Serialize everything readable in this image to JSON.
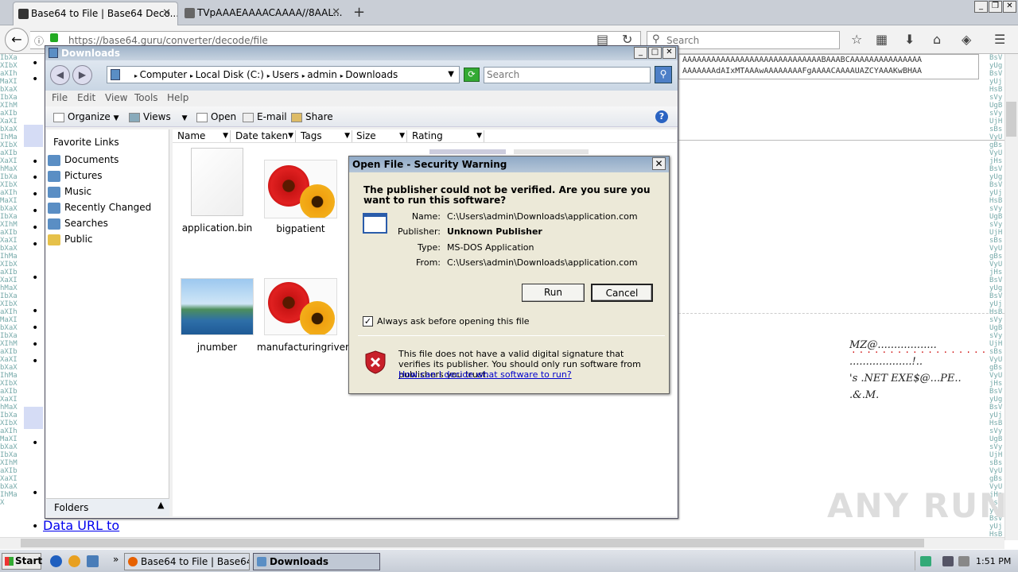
{
  "browser": {
    "tabs": [
      {
        "label": "Base64 to File | Base64 Deco...",
        "active": true
      },
      {
        "label": "TVpAAAEAAAACAAAA//8AAL...",
        "active": false
      }
    ],
    "url": "https://base64.guru/converter/decode/file",
    "search_placeholder": "Search"
  },
  "page": {
    "textarea_lines": [
      "AAAAAAAAAAAAAAAAAAAAAAAAAAAAABAAABCAAAAAAAAAAAAAAA",
      "AAAAAAAdAIxMTAAAwAAAAAAAAFgAAAACAAAAUAZCYAAAKwBHAA"
    ],
    "data_url_link": "Data URL to",
    "decoded_lines": [
      "MZ@..................",
      "...................!..",
      "'s .NET EXE$@...PE..",
      ".&.M."
    ],
    "left_strip": "IbXaXIbXaXIhMaXIbXaXIbXaXIhMaXIbXaXIbXaXIhMaXIbXaXIbXaXIhMaXIbXaXIbXaXIhMaXIbXaXIbXaXIhMaXIbXaXIbXaXIhMaXIbXaXIbXaXIhMaXIbXaXIbXaXIhMaXIbXaXIbXaXIhMaXIbXaXIbXaXIhMaXIbXaXIbXaXIhMaXIbXaXIbXaXIhMaXIbXaXIbXaXIhMaXIbXaXIbXaXIhMaX",
    "right_strip": "BsVyUgBsVyUjHsBsVyUgBsVyUjHsBsVyUgBsVyUjHsBsVyUgBsVyUjHsBsVyUgBsVyUjHsBsVyUgBsVyUjHsBsVyUgBsVyUjHsBsVyUgBsVyUjHsBsVyUgBsVyUjHsBsVyUgBsVyUjHsBsVyUgBsVyUjHsBsVyUgBsVyUjHsBsVyUgBsVyUjHsBsVyUgBsVyUjHs",
    "watermark": "ANY RUN"
  },
  "explorer": {
    "title": "Downloads",
    "breadcrumb": [
      "Computer",
      "Local Disk (C:)",
      "Users",
      "admin",
      "Downloads"
    ],
    "search_placeholder": "Search",
    "menu": [
      "File",
      "Edit",
      "View",
      "Tools",
      "Help"
    ],
    "toolbar": {
      "organize": "Organize",
      "views": "Views",
      "open": "Open",
      "email": "E-mail",
      "share": "Share"
    },
    "favorite_links_title": "Favorite Links",
    "favorites": [
      "Documents",
      "Pictures",
      "Music",
      "Recently Changed",
      "Searches",
      "Public"
    ],
    "folders_label": "Folders",
    "columns": [
      "Name",
      "Date taken",
      "Tags",
      "Size",
      "Rating"
    ],
    "files": [
      "application.bin",
      "bigpatient",
      "jnumber",
      "manufacturingriver"
    ]
  },
  "dialog": {
    "title": "Open File - Security Warning",
    "question": "The publisher could not be verified.  Are you sure you want to run this software?",
    "fields": [
      {
        "label": "Name:",
        "value": "C:\\Users\\admin\\Downloads\\application.com"
      },
      {
        "label": "Publisher:",
        "value": "Unknown Publisher"
      },
      {
        "label": "Type:",
        "value": "MS-DOS Application"
      },
      {
        "label": "From:",
        "value": "C:\\Users\\admin\\Downloads\\application.com"
      }
    ],
    "run_label": "Run",
    "cancel_label": "Cancel",
    "checkbox_label": "Always ask before opening this file",
    "checkbox_checked": true,
    "warning_text": "This file does not have a valid digital signature that verifies its publisher.  You should only run software from publishers you trust.",
    "link_text": "How can I decide what software to run?"
  },
  "taskbar": {
    "start_label": "Start",
    "tasks": [
      {
        "label": "Base64 to File | Base64 ...",
        "active": false
      },
      {
        "label": "Downloads",
        "active": true
      }
    ],
    "clock": "1:51 PM"
  }
}
